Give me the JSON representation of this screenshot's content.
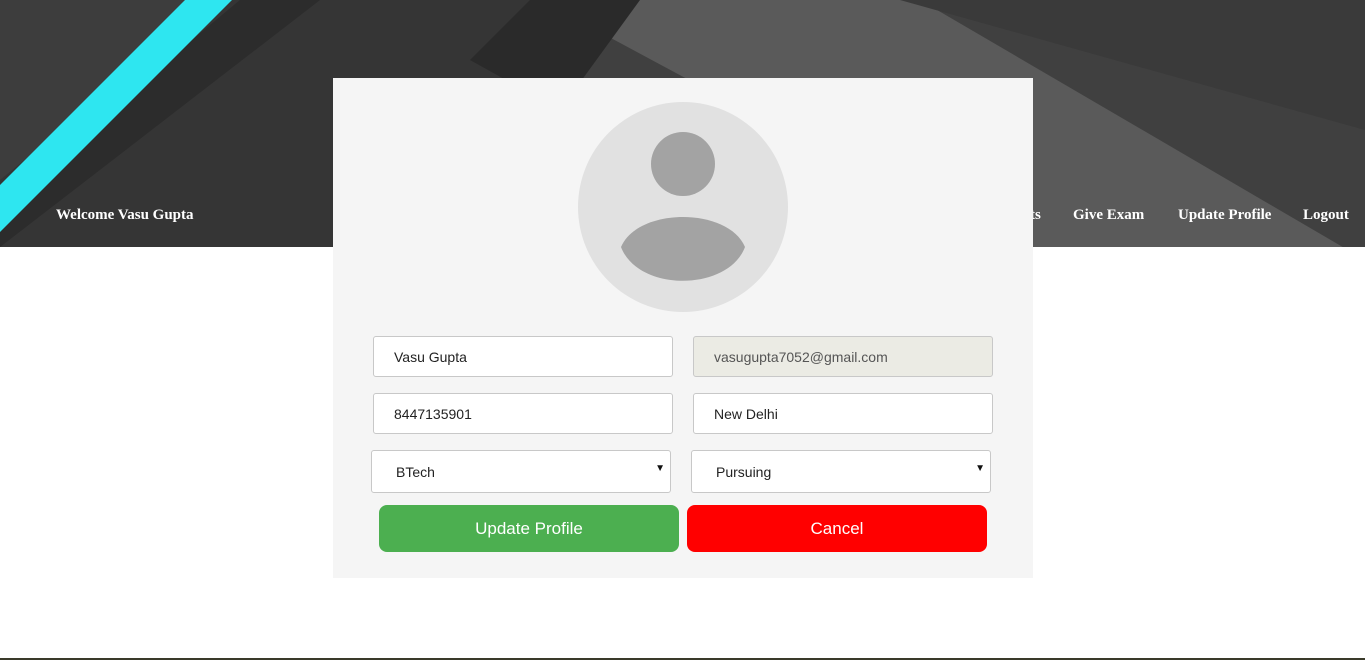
{
  "header": {
    "welcome": "Welcome Vasu Gupta",
    "nav": [
      {
        "label": "ts"
      },
      {
        "label": "Give Exam"
      },
      {
        "label": "Update Profile"
      },
      {
        "label": "Logout"
      }
    ]
  },
  "profile": {
    "avatar_icon": "user-avatar-icon",
    "name": "Vasu Gupta",
    "email": "vasugupta7052@gmail.com",
    "phone": "8447135901",
    "city": "New Delhi",
    "course": "BTech",
    "status": "Pursuing"
  },
  "actions": {
    "update_label": "Update Profile",
    "cancel_label": "Cancel"
  },
  "colors": {
    "accent_cyan": "#2ee6f0",
    "update_button": "#4caf50",
    "cancel_button": "#ff0000"
  }
}
